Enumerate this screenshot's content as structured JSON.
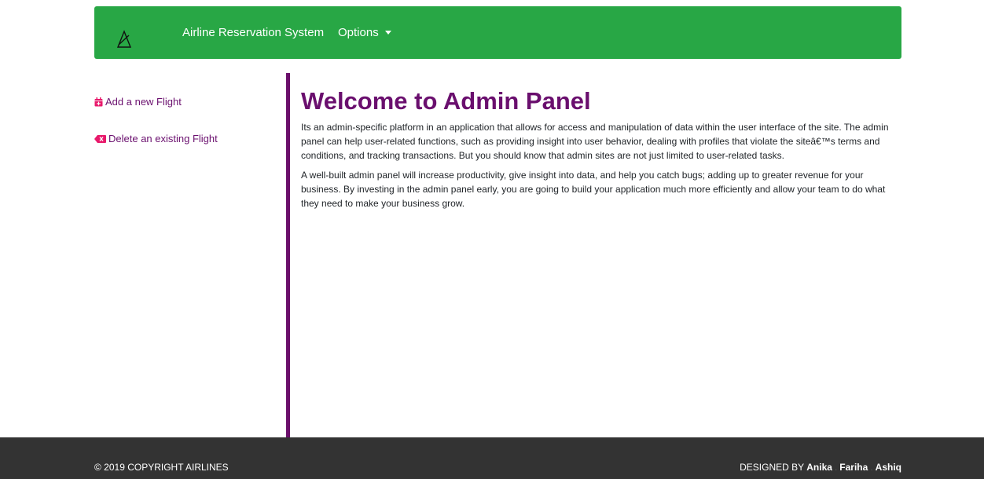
{
  "navbar": {
    "brand_title": "Airline Reservation System",
    "options_label": "Options",
    "brand_color": "#28a745"
  },
  "sidebar": {
    "items": [
      {
        "label": "Add a new Flight",
        "icon": "calendar-plus-icon"
      },
      {
        "label": "Delete an existing Flight",
        "icon": "backspace-icon"
      }
    ],
    "link_color": "#6a0f6e"
  },
  "main": {
    "title": "Welcome to Admin Panel",
    "paragraphs": [
      "Its an admin-specific platform in an application that allows for access and manipulation of data within the user interface of the site. The admin panel can help user-related functions, such as providing insight into user behavior, dealing with profiles that violate the siteâ€™s terms and conditions, and tracking transactions. But you should know that admin sites are not just limited to user-related tasks.",
      "A well-built admin panel will increase productivity, give insight into data, and help you catch bugs; adding up to greater revenue for your business. By investing in the admin panel early, you are going to build your application much more efficiently and allow your team to do what they need to make your business grow."
    ],
    "accent_color": "#6b0f6b"
  },
  "footer": {
    "copyright": "© 2019 COPYRIGHT AIRLINES",
    "designed_by": "DESIGNED BY",
    "designers": [
      "Anika",
      "Fariha",
      "Ashiq"
    ],
    "separator": ".",
    "background": "#333333"
  }
}
